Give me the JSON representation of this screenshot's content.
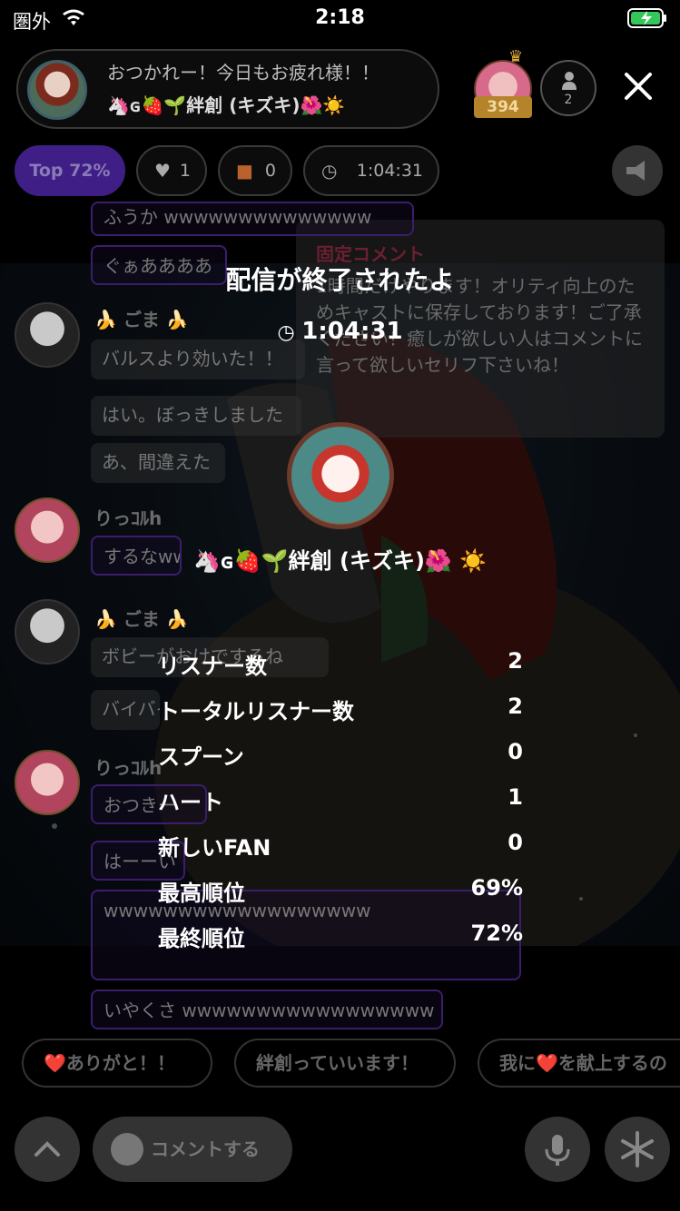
{
  "status_bar": {
    "carrier": "圏外",
    "time": "2:18"
  },
  "header": {
    "title_line1": "おつかれー！今日もお疲れ様！！",
    "title_line2": "🦄ɢ🍓🌱絆創 (キズキ)🌺☀️",
    "rank_badge": "394",
    "listener_count": "2"
  },
  "chips": {
    "top": "Top 72%",
    "hearts": "1",
    "gifts": "0",
    "duration": "1:04:31"
  },
  "pinned": {
    "title": "固定コメント",
    "body": "1時間だけやります！オリティ向上のためキャストに保存しております！ご了承ください！癒しが欲しい人はコメントに言って欲しいセリフ下さいね！"
  },
  "chat": {
    "top_cut": "ふうか wwwwwwwwwwwwww",
    "b1": "ぐぁああああ",
    "name_goma": "🍌 ごま 🍌",
    "b2": "バルスより効いた！！",
    "b3": "はい。ぼっきしました",
    "b4": "あ、間違えた",
    "name_ritto": "りっｺﾙh",
    "b5": "するなww",
    "b6": "ボビーがおけでするね",
    "b7": "バイバイ",
    "b8": "おつきー",
    "b9": "はーーい",
    "b10": "wwwwwwwwwwwwwwwwww",
    "b11": "いやくさ wwwwwwwwwwwwwwwww"
  },
  "end": {
    "title": "配信が終了されたよ",
    "time": "1:04:31",
    "dj_name": "🦄ɢ🍓🌱絆創 (キズキ)🌺 ☀️"
  },
  "stats": [
    {
      "label": "リスナー数",
      "value": "2"
    },
    {
      "label": "トータルリスナー数",
      "value": "2"
    },
    {
      "label": "スプーン",
      "value": "0"
    },
    {
      "label": "ハート",
      "value": "1"
    },
    {
      "label": "新しいFAN",
      "value": "0"
    },
    {
      "label": "最高順位",
      "value": "69%"
    },
    {
      "label": "最終順位",
      "value": "72%"
    }
  ],
  "reactions": {
    "r1": "❤️ありがと！！",
    "r2": "絆創っていいます！",
    "r3": "我に❤️を献上するの"
  },
  "bottom": {
    "comment": "コメントする"
  },
  "colors": {
    "accent_purple": "#3f1f86",
    "pinned_title": "#6a2030",
    "rank_gold": "#b5842a"
  }
}
